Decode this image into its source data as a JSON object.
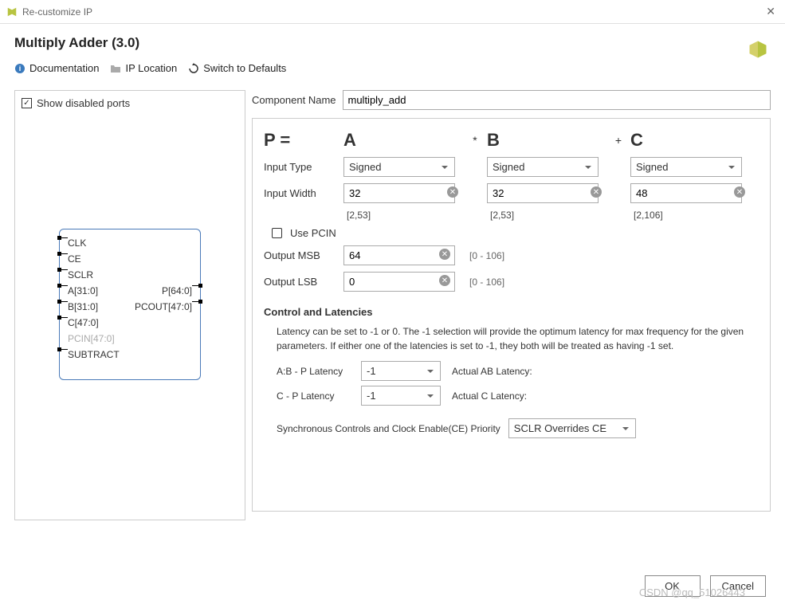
{
  "window": {
    "title": "Re-customize IP"
  },
  "header": {
    "title": "Multiply Adder (3.0)"
  },
  "toolbar": {
    "doc": "Documentation",
    "loc": "IP Location",
    "defaults": "Switch to Defaults"
  },
  "left": {
    "show_disabled": "Show disabled ports",
    "ports": {
      "left": [
        "CLK",
        "CE",
        "SCLR",
        "A[31:0]",
        "B[31:0]",
        "C[47:0]",
        "PCIN[47:0]",
        "SUBTRACT"
      ],
      "right": [
        "P[64:0]",
        "PCOUT[47:0]"
      ],
      "disabled_idx_left": 6
    }
  },
  "config": {
    "comp_name_label": "Component Name",
    "comp_name": "multiply_add",
    "formula": {
      "p": "P =",
      "a": "A",
      "star": "*",
      "b": "B",
      "plus": "+",
      "c": "C"
    },
    "labels": {
      "input_type": "Input Type",
      "input_width": "Input Width"
    },
    "a": {
      "type": "Signed",
      "width": "32",
      "range": "[2,53]"
    },
    "b": {
      "type": "Signed",
      "width": "32",
      "range": "[2,53]"
    },
    "c": {
      "type": "Signed",
      "width": "48",
      "range": "[2,106]"
    },
    "use_pcin": "Use PCIN",
    "out_msb_label": "Output MSB",
    "out_msb": "64",
    "out_msb_hint": "[0 - 106]",
    "out_lsb_label": "Output LSB",
    "out_lsb": "0",
    "out_lsb_hint": "[0 - 106]",
    "section": "Control and Latencies",
    "lat_desc": "Latency can be set to -1 or 0. The -1 selection will provide the optimum latency for max frequency for the given parameters. If either one of the latencies is set to -1, they both will be treated as having -1 set.",
    "ab_lat_label": "A:B - P Latency",
    "ab_lat": "-1",
    "ab_actual": "Actual AB Latency:",
    "c_lat_label": "C - P Latency",
    "c_lat": "-1",
    "c_actual": "Actual C Latency:",
    "priority_label": "Synchronous Controls and Clock Enable(CE) Priority",
    "priority": "SCLR Overrides CE"
  },
  "footer": {
    "ok": "OK",
    "cancel": "Cancel"
  },
  "watermark": "CSDN @qq_51026443"
}
